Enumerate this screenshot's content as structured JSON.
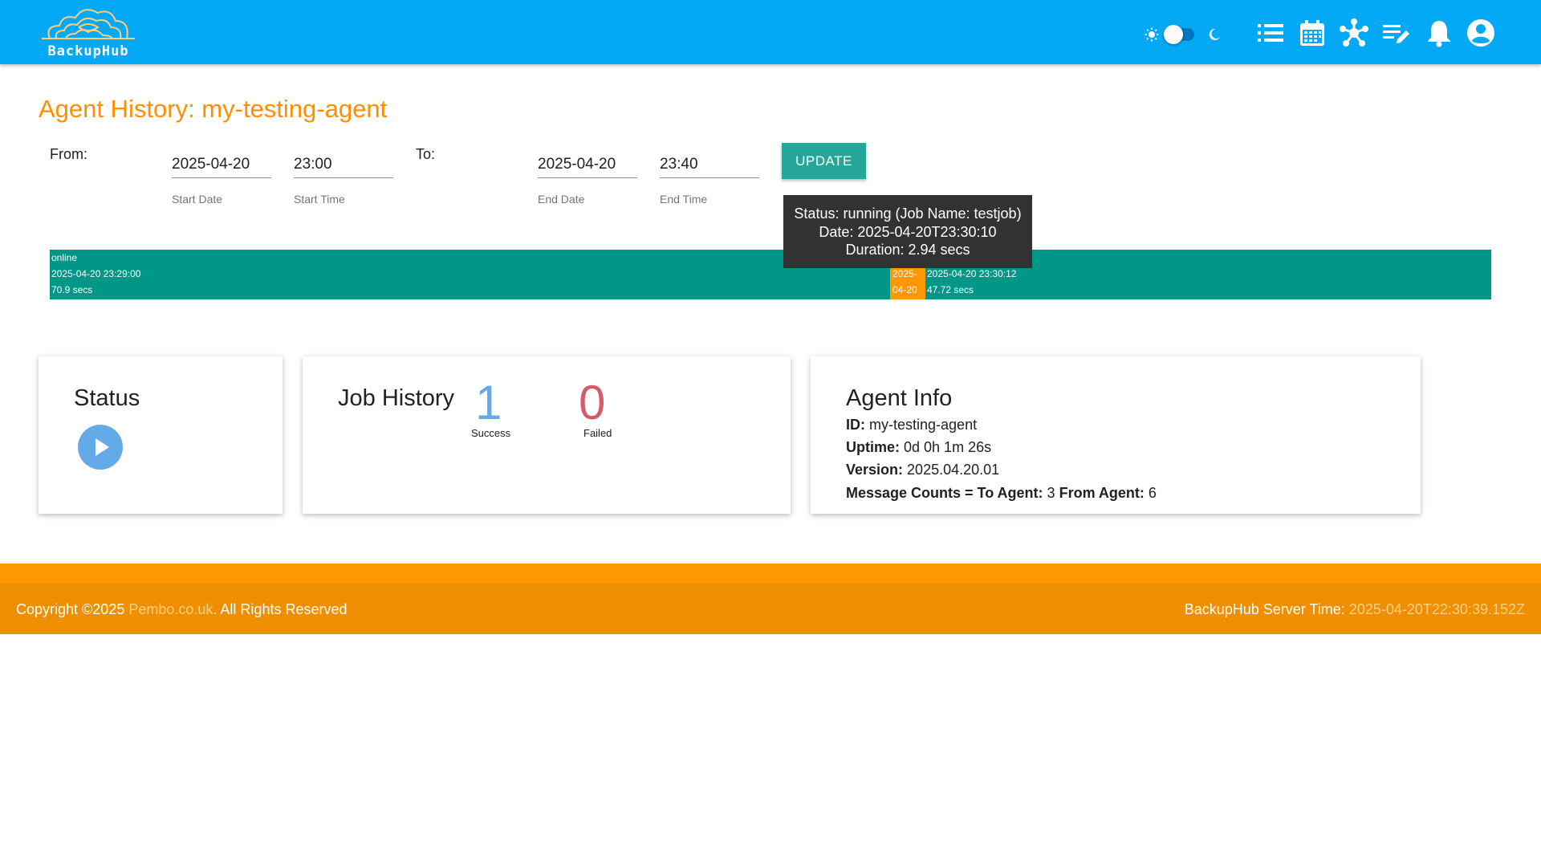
{
  "header": {
    "logo_text": "BackupHub",
    "theme_toggle": {
      "state": "light"
    },
    "nav_icons": [
      "list-icon",
      "calendar-icon",
      "network-icon",
      "edit-list-icon",
      "bell-icon",
      "account-icon"
    ]
  },
  "page": {
    "title": "Agent History: my-testing-agent"
  },
  "form": {
    "from_label": "From:",
    "to_label": "To:",
    "start_date": {
      "value": "2025-04-20",
      "hint": "Start Date"
    },
    "start_time": {
      "value": "23:00",
      "hint": "Start Time"
    },
    "end_date": {
      "value": "2025-04-20",
      "hint": "End Date"
    },
    "end_time": {
      "value": "23:40",
      "hint": "End Time"
    },
    "update_label": "UPDATE"
  },
  "timeline": {
    "segment1": {
      "status": "online",
      "start": "2025-04-20 23:29:00",
      "duration": "70.9 secs"
    },
    "segment2": {
      "line1": "2025-",
      "line2": "04-20"
    },
    "segment3": {
      "start": "2025-04-20 23:30:12",
      "duration": "47.72 secs"
    },
    "tooltip": {
      "line1": "Status: running (Job Name: testjob)",
      "line2": "Date: 2025-04-20T23:30:10",
      "line3": "Duration: 2.94 secs"
    }
  },
  "status_card": {
    "title": "Status",
    "icon": "play-icon"
  },
  "job_history": {
    "title": "Job History",
    "success_count": "1",
    "success_label": "Success",
    "failed_count": "0",
    "failed_label": "Failed"
  },
  "agent_info": {
    "title": "Agent Info",
    "id_label": "ID:",
    "id_value": "my-testing-agent",
    "uptime_label": "Uptime:",
    "uptime_value": "0d 0h 1m 26s",
    "version_label": "Version:",
    "version_value": "2025.04.20.01",
    "msg_label": "Message Counts = To Agent:",
    "to_agent": "3",
    "from_label": "From Agent:",
    "from_agent": "6"
  },
  "footer": {
    "copyright_prefix": "Copyright ©2025",
    "link_text": "Pembo.co.uk",
    "copyright_suffix": ". All Rights Reserved",
    "server_time_label": "BackupHub Server Time:",
    "server_time": "2025-04-20T22:30:39.152Z"
  },
  "colors": {
    "header": "#03a9f4",
    "title": "#ff8f00",
    "timeline": "#009688",
    "running": "#ff9800",
    "update_button": "#26a69a",
    "success": "#64a9e8",
    "failed": "#d35b6a",
    "footer": "#ef8f00"
  }
}
